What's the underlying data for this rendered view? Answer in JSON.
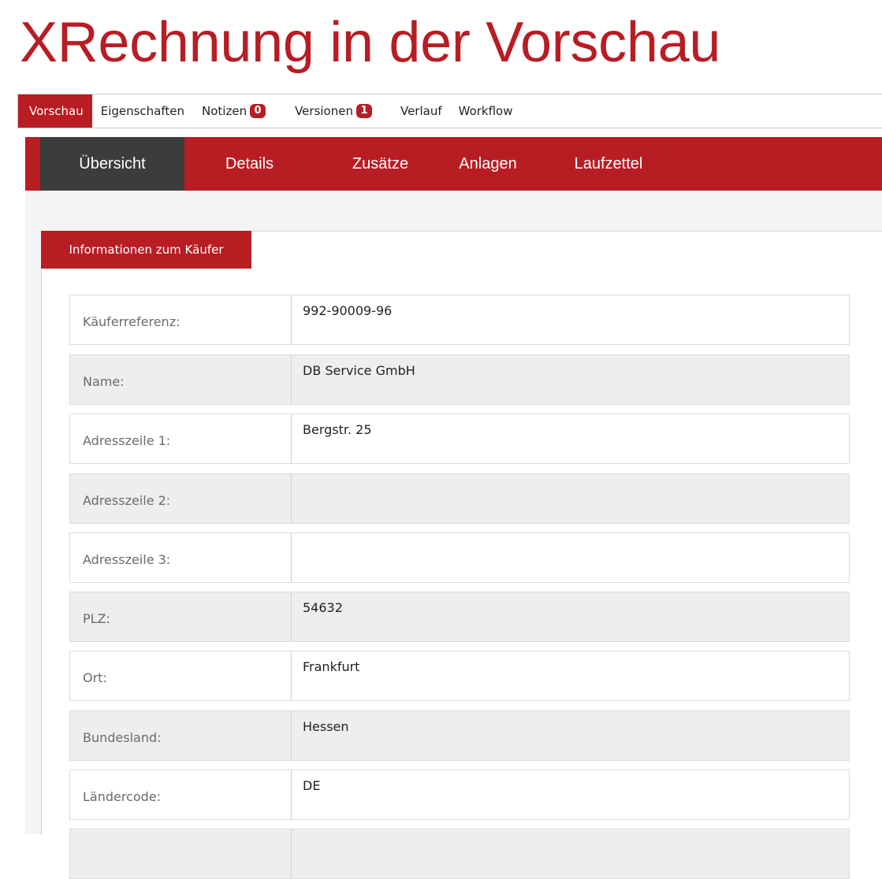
{
  "page": {
    "title": "XRechnung in der Vorschau"
  },
  "top_tabs": [
    {
      "label": "Vorschau",
      "badge": "",
      "active": true
    },
    {
      "label": "Eigenschaften",
      "badge": ""
    },
    {
      "label": "Notizen",
      "badge": "0"
    },
    {
      "label": "Versionen",
      "badge": "1"
    },
    {
      "label": "Verlauf",
      "badge": ""
    },
    {
      "label": "Workflow",
      "badge": ""
    }
  ],
  "sub_tabs": [
    {
      "label": "Übersicht",
      "active": true
    },
    {
      "label": "Details"
    },
    {
      "label": "Zusätze"
    },
    {
      "label": "Anlagen"
    },
    {
      "label": "Laufzettel"
    }
  ],
  "panel": {
    "header": "Informationen zum Käufer",
    "rows": [
      {
        "label": "Käuferreferenz:",
        "value": "992-90009-96"
      },
      {
        "label": "Name:",
        "value": "DB Service GmbH"
      },
      {
        "label": "Adresszeile 1:",
        "value": "Bergstr. 25"
      },
      {
        "label": "Adresszeile 2:",
        "value": ""
      },
      {
        "label": "Adresszeile 3:",
        "value": ""
      },
      {
        "label": "PLZ:",
        "value": "54632"
      },
      {
        "label": "Ort:",
        "value": "Frankfurt"
      },
      {
        "label": "Bundesland:",
        "value": "Hessen"
      },
      {
        "label": "Ländercode:",
        "value": "DE"
      },
      {
        "label": "",
        "value": ""
      }
    ]
  },
  "colors": {
    "accent": "#b81d24",
    "active_subtab": "#3c3c3c"
  }
}
